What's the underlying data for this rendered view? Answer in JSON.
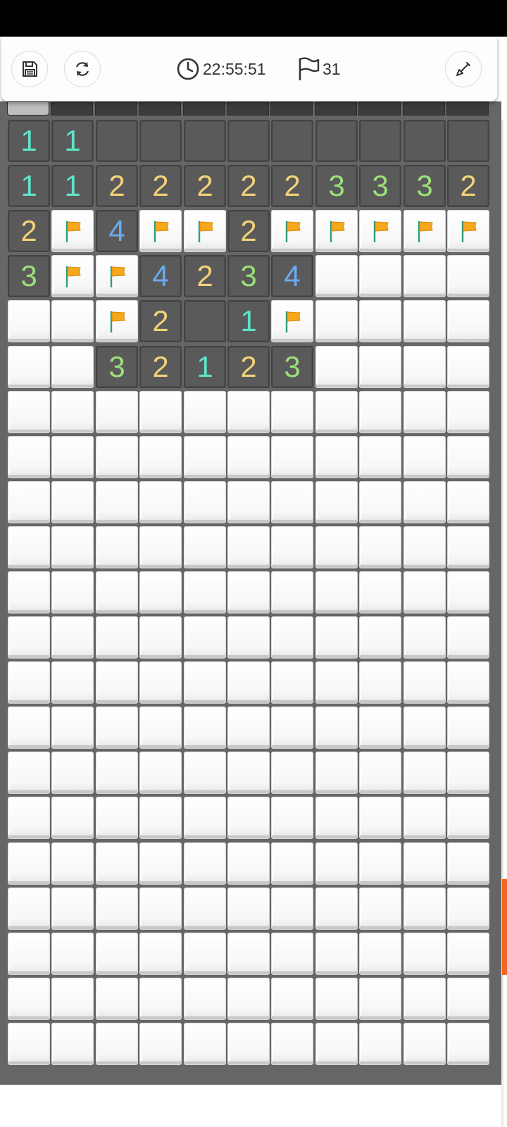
{
  "header": {
    "timer": "22:55:51",
    "flags_count": "31",
    "icons": {
      "save": "save-icon",
      "restart": "refresh-icon",
      "timer": "clock-icon",
      "flags": "flag-outline-icon",
      "mode": "shovel-icon"
    }
  },
  "board": {
    "columns": 11,
    "rows": [
      [
        "1",
        "1",
        "o",
        "o",
        "o",
        "o",
        "o",
        "o",
        "o",
        "o",
        "o"
      ],
      [
        "1",
        "1",
        "2",
        "2",
        "2",
        "2",
        "2",
        "3",
        "3",
        "3",
        "2"
      ],
      [
        "2",
        "F",
        "4",
        "F",
        "F",
        "2",
        "F",
        "F",
        "F",
        "F",
        "F"
      ],
      [
        "3",
        "F",
        "F",
        "4",
        "2",
        "3",
        "4",
        "U",
        "U",
        "U",
        "U"
      ],
      [
        "U",
        "U",
        "F",
        "2",
        "o",
        "1",
        "F",
        "U",
        "U",
        "U",
        "U"
      ],
      [
        "U",
        "U",
        "3",
        "2",
        "1",
        "2",
        "3",
        "U",
        "U",
        "U",
        "U"
      ],
      [
        "U",
        "U",
        "U",
        "U",
        "U",
        "U",
        "U",
        "U",
        "U",
        "U",
        "U"
      ],
      [
        "U",
        "U",
        "U",
        "U",
        "U",
        "U",
        "U",
        "U",
        "U",
        "U",
        "U"
      ],
      [
        "U",
        "U",
        "U",
        "U",
        "U",
        "U",
        "U",
        "U",
        "U",
        "U",
        "U"
      ],
      [
        "U",
        "U",
        "U",
        "U",
        "U",
        "U",
        "U",
        "U",
        "U",
        "U",
        "U"
      ],
      [
        "U",
        "U",
        "U",
        "U",
        "U",
        "U",
        "U",
        "U",
        "U",
        "U",
        "U"
      ],
      [
        "U",
        "U",
        "U",
        "U",
        "U",
        "U",
        "U",
        "U",
        "U",
        "U",
        "U"
      ],
      [
        "U",
        "U",
        "U",
        "U",
        "U",
        "U",
        "U",
        "U",
        "U",
        "U",
        "U"
      ],
      [
        "U",
        "U",
        "U",
        "U",
        "U",
        "U",
        "U",
        "U",
        "U",
        "U",
        "U"
      ],
      [
        "U",
        "U",
        "U",
        "U",
        "U",
        "U",
        "U",
        "U",
        "U",
        "U",
        "U"
      ],
      [
        "U",
        "U",
        "U",
        "U",
        "U",
        "U",
        "U",
        "U",
        "U",
        "U",
        "U"
      ],
      [
        "U",
        "U",
        "U",
        "U",
        "U",
        "U",
        "U",
        "U",
        "U",
        "U",
        "U"
      ],
      [
        "U",
        "U",
        "U",
        "U",
        "U",
        "U",
        "U",
        "U",
        "U",
        "U",
        "U"
      ],
      [
        "U",
        "U",
        "U",
        "U",
        "U",
        "U",
        "U",
        "U",
        "U",
        "U",
        "U"
      ],
      [
        "U",
        "U",
        "U",
        "U",
        "U",
        "U",
        "U",
        "U",
        "U",
        "U",
        "U"
      ],
      [
        "U",
        "U",
        "U",
        "U",
        "U",
        "U",
        "U",
        "U",
        "U",
        "U",
        "U"
      ]
    ],
    "number_colors": {
      "1": "#5fe3c8",
      "2": "#f3d27a",
      "3": "#9be079",
      "4": "#6aaaf0"
    },
    "flag_color": "#f5a81c",
    "accent_color": "#f26522"
  }
}
